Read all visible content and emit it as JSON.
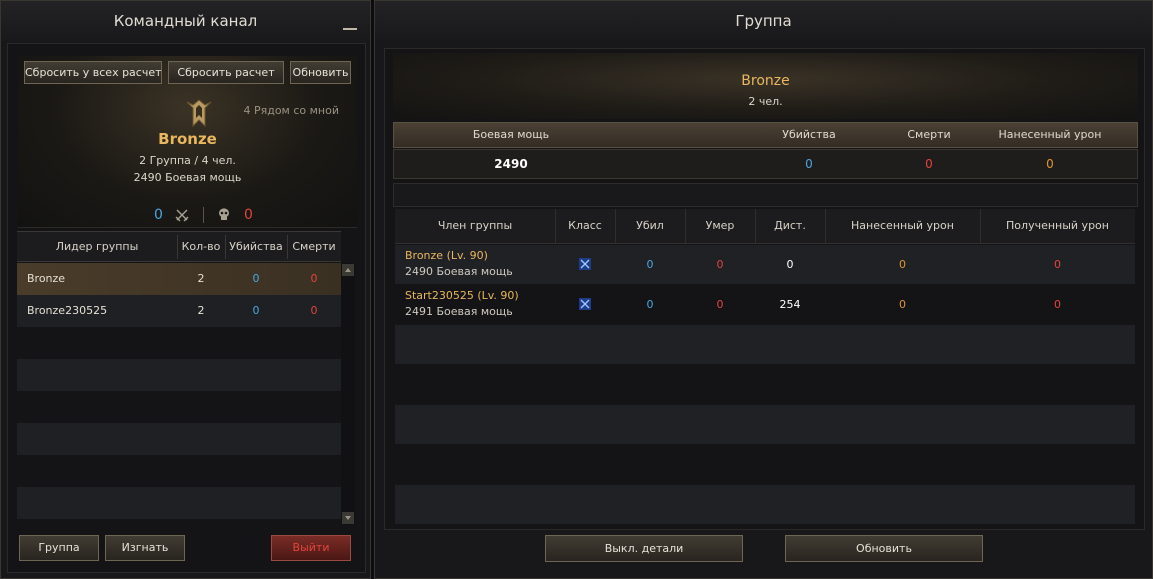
{
  "left": {
    "title": "Командный канал",
    "buttons": {
      "reset_all": "Сбросить у всех расчет",
      "reset": "Сбросить расчет",
      "refresh": "Обновить"
    },
    "nearby": "4 Рядом со мной",
    "team": {
      "name": "Bronze",
      "groups": "2 Группа / 4 чел.",
      "power": "2490 Боевая мощь",
      "kills": "0",
      "deaths": "0"
    },
    "columns": [
      "Лидер группы",
      "Кол-во",
      "Убийства",
      "Смерти"
    ],
    "rows": [
      {
        "leader": "Bronze",
        "count": "2",
        "kills": "0",
        "deaths": "0"
      },
      {
        "leader": "Bronze230525",
        "count": "2",
        "kills": "0",
        "deaths": "0"
      }
    ],
    "bottom": {
      "group": "Группа",
      "kick": "Изгнать",
      "exit": "Выйти"
    }
  },
  "right": {
    "title": "Группа",
    "group_name": "Bronze",
    "group_count": "2 чел.",
    "stats_columns": [
      "Боевая мощь",
      "Убийства",
      "Смерти",
      "Нанесенный урон"
    ],
    "stats": {
      "power": "2490",
      "kills": "0",
      "deaths": "0",
      "damage": "0"
    },
    "member_columns": [
      "Член группы",
      "Класс",
      "Убил",
      "Умер",
      "Дист.",
      "Нанесенный урон",
      "Полученный урон"
    ],
    "members": [
      {
        "name": "Bronze (Lv. 90)",
        "power": "2490 Боевая мощь",
        "class_icon": "crossed-swords-icon",
        "kills": "0",
        "deaths": "0",
        "distance": "0",
        "dealt": "0",
        "received": "0"
      },
      {
        "name": "Start230525 (Lv. 90)",
        "power": "2491 Боевая мощь",
        "class_icon": "crossed-swords-icon",
        "kills": "0",
        "deaths": "0",
        "distance": "254",
        "dealt": "0",
        "received": "0"
      }
    ],
    "bottom": {
      "details_off": "Выкл. детали",
      "refresh": "Обновить"
    }
  },
  "colors": {
    "gold": "#e8b75e",
    "blue": "#4aa6e0",
    "red": "#e2443c",
    "orange": "#e0962e"
  }
}
